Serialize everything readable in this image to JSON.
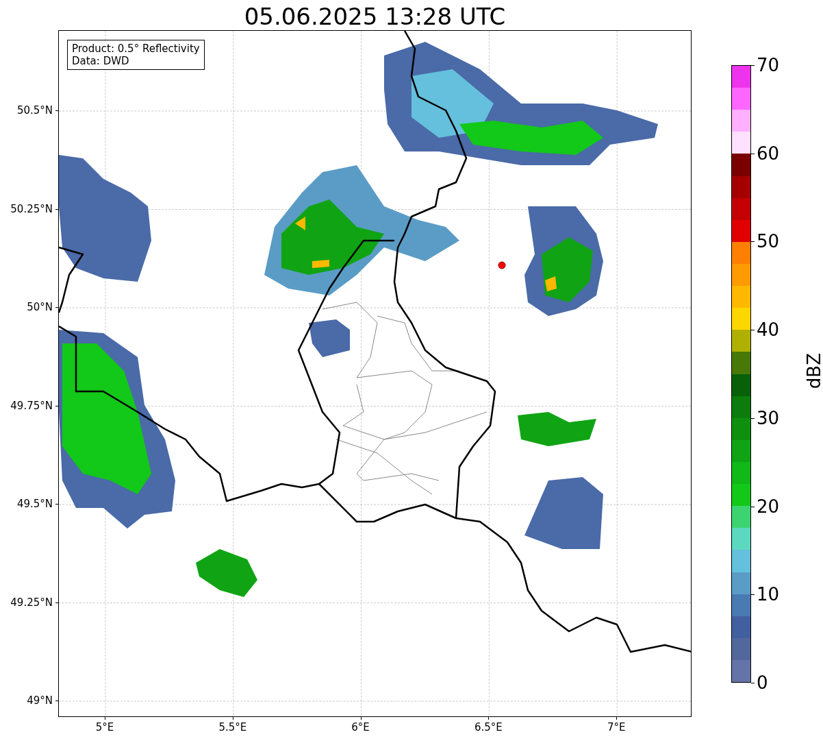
{
  "title": "05.06.2025 13:28 UTC",
  "info_box": {
    "lines": [
      "Product: 0.5° Reflectivity",
      "Data: DWD"
    ]
  },
  "map": {
    "y_ticks": [
      "50.5°N",
      "50.25°N",
      "50°N",
      "49.75°N",
      "49.5°N",
      "49.25°N",
      "49°N"
    ],
    "x_ticks": [
      "5°E",
      "5.5°E",
      "6°E",
      "6.5°E",
      "7°E"
    ]
  },
  "colorbar": {
    "label": "dBZ",
    "ticks": [
      "70",
      "60",
      "50",
      "40",
      "30",
      "20",
      "10",
      "0"
    ],
    "levels": [
      {
        "color": "#ee33ee"
      },
      {
        "color": "#ff66ff"
      },
      {
        "color": "#ffb0ff"
      },
      {
        "color": "#ffe0ff"
      },
      {
        "color": "#7a0000"
      },
      {
        "color": "#a40000"
      },
      {
        "color": "#c40000"
      },
      {
        "color": "#e00000"
      },
      {
        "color": "#ff7f00"
      },
      {
        "color": "#ff9a00"
      },
      {
        "color": "#ffb800"
      },
      {
        "color": "#ffd700"
      },
      {
        "color": "#b0b000"
      },
      {
        "color": "#487808"
      },
      {
        "color": "#086008"
      },
      {
        "color": "#0c7c0c"
      },
      {
        "color": "#0e900e"
      },
      {
        "color": "#10a414"
      },
      {
        "color": "#10b818"
      },
      {
        "color": "#12c818"
      },
      {
        "color": "#3cd470"
      },
      {
        "color": "#5cd8c0"
      },
      {
        "color": "#64c0dc"
      },
      {
        "color": "#5a9cc6"
      },
      {
        "color": "#4a7ab2"
      },
      {
        "color": "#4260a0"
      },
      {
        "color": "#52689c"
      },
      {
        "color": "#6474a8"
      }
    ]
  }
}
